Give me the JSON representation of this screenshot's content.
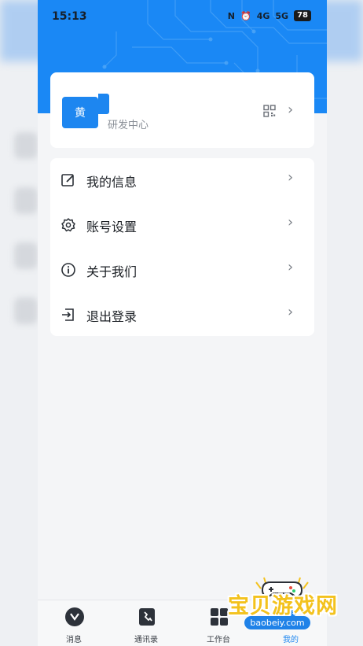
{
  "status_bar": {
    "time": "15:13",
    "indicators": [
      "N",
      "⏰",
      "4G",
      "5G"
    ],
    "battery": "78"
  },
  "profile": {
    "avatar_text": "黄",
    "department": "研发中心",
    "qr_icon": "qr-code-icon",
    "chevron": "›"
  },
  "menu": [
    {
      "label": "我的信息",
      "icon": "edit-icon"
    },
    {
      "label": "账号设置",
      "icon": "gear-icon"
    },
    {
      "label": "关于我们",
      "icon": "info-icon"
    },
    {
      "label": "退出登录",
      "icon": "logout-icon"
    }
  ],
  "tabs": [
    {
      "label": "消息",
      "icon": "message-icon"
    },
    {
      "label": "通讯录",
      "icon": "contacts-icon"
    },
    {
      "label": "工作台",
      "icon": "workbench-icon"
    },
    {
      "label": "我的",
      "icon": "profile-icon"
    }
  ],
  "watermark": {
    "title": "宝贝游戏网",
    "url": "baobeiy.com"
  },
  "colors": {
    "header_blue": "#1a88f5",
    "accent_blue": "#1d86f0",
    "background": "#f4f5f7",
    "watermark_yellow": "#f3c21d"
  }
}
